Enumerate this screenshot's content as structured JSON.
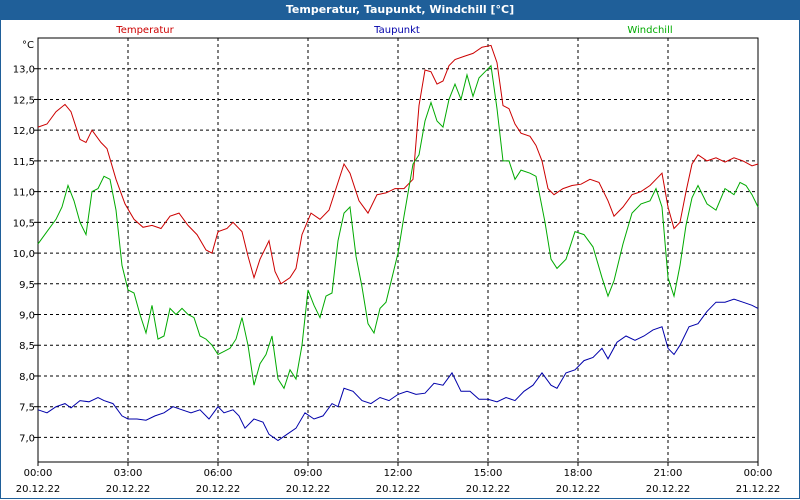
{
  "window": {
    "title": "Temperatur, Taupunkt, Windchill [°C]"
  },
  "chart_data": {
    "type": "line",
    "title": "Temperatur, Taupunkt, Windchill [°C]",
    "ylabel": "°C",
    "ylim": [
      6.6,
      13.5
    ],
    "xlim": [
      0,
      24
    ],
    "grid": true,
    "legend_placement": "top",
    "y_ticks": [
      "7,0",
      "7,5",
      "8,0",
      "8,5",
      "9,0",
      "9,5",
      "10,0",
      "10,5",
      "11,0",
      "11,5",
      "12,0",
      "12,5",
      "13,0"
    ],
    "x_ticks": [
      {
        "time": "00:00",
        "date": "20.12.22"
      },
      {
        "time": "03:00",
        "date": "20.12.22"
      },
      {
        "time": "06:00",
        "date": "20.12.22"
      },
      {
        "time": "09:00",
        "date": "20.12.22"
      },
      {
        "time": "12:00",
        "date": "20.12.22"
      },
      {
        "time": "15:00",
        "date": "20.12.22"
      },
      {
        "time": "18:00",
        "date": "20.12.22"
      },
      {
        "time": "21:00",
        "date": "20.12.22"
      },
      {
        "time": "00:00",
        "date": "21.12.22"
      }
    ],
    "series": [
      {
        "name": "Temperatur",
        "color": "#cc0000",
        "points": [
          [
            0,
            12.05
          ],
          [
            0.3,
            12.1
          ],
          [
            0.6,
            12.3
          ],
          [
            0.9,
            12.42
          ],
          [
            1.1,
            12.3
          ],
          [
            1.4,
            11.85
          ],
          [
            1.6,
            11.8
          ],
          [
            1.8,
            12.0
          ],
          [
            2.1,
            11.8
          ],
          [
            2.3,
            11.7
          ],
          [
            2.6,
            11.2
          ],
          [
            2.9,
            10.8
          ],
          [
            3.2,
            10.55
          ],
          [
            3.5,
            10.42
          ],
          [
            3.8,
            10.45
          ],
          [
            4.1,
            10.4
          ],
          [
            4.4,
            10.6
          ],
          [
            4.7,
            10.65
          ],
          [
            5.0,
            10.45
          ],
          [
            5.3,
            10.3
          ],
          [
            5.6,
            10.05
          ],
          [
            5.8,
            10.0
          ],
          [
            6.0,
            10.35
          ],
          [
            6.3,
            10.4
          ],
          [
            6.5,
            10.5
          ],
          [
            6.8,
            10.35
          ],
          [
            7.0,
            9.95
          ],
          [
            7.2,
            9.6
          ],
          [
            7.4,
            9.9
          ],
          [
            7.7,
            10.2
          ],
          [
            7.9,
            9.7
          ],
          [
            8.1,
            9.5
          ],
          [
            8.4,
            9.6
          ],
          [
            8.6,
            9.75
          ],
          [
            8.8,
            10.3
          ],
          [
            9.1,
            10.65
          ],
          [
            9.4,
            10.55
          ],
          [
            9.7,
            10.7
          ],
          [
            9.9,
            11.0
          ],
          [
            10.2,
            11.45
          ],
          [
            10.4,
            11.3
          ],
          [
            10.7,
            10.85
          ],
          [
            11.0,
            10.65
          ],
          [
            11.3,
            10.95
          ],
          [
            11.6,
            10.98
          ],
          [
            11.9,
            11.05
          ],
          [
            12.2,
            11.05
          ],
          [
            12.5,
            11.2
          ],
          [
            12.7,
            12.4
          ],
          [
            12.9,
            12.98
          ],
          [
            13.1,
            12.95
          ],
          [
            13.3,
            12.75
          ],
          [
            13.5,
            12.8
          ],
          [
            13.7,
            13.05
          ],
          [
            13.9,
            13.15
          ],
          [
            14.2,
            13.2
          ],
          [
            14.5,
            13.25
          ],
          [
            14.8,
            13.35
          ],
          [
            15.1,
            13.38
          ],
          [
            15.3,
            13.1
          ],
          [
            15.5,
            12.4
          ],
          [
            15.7,
            12.35
          ],
          [
            15.9,
            12.1
          ],
          [
            16.1,
            11.95
          ],
          [
            16.4,
            11.9
          ],
          [
            16.6,
            11.75
          ],
          [
            16.8,
            11.5
          ],
          [
            17.0,
            11.05
          ],
          [
            17.2,
            10.95
          ],
          [
            17.5,
            11.05
          ],
          [
            17.8,
            11.1
          ],
          [
            18.1,
            11.12
          ],
          [
            18.4,
            11.2
          ],
          [
            18.7,
            11.15
          ],
          [
            19.0,
            10.85
          ],
          [
            19.2,
            10.6
          ],
          [
            19.5,
            10.75
          ],
          [
            19.8,
            10.95
          ],
          [
            20.1,
            11.0
          ],
          [
            20.4,
            11.1
          ],
          [
            20.6,
            11.2
          ],
          [
            20.8,
            11.3
          ],
          [
            21.0,
            10.75
          ],
          [
            21.2,
            10.4
          ],
          [
            21.4,
            10.5
          ],
          [
            21.6,
            11.0
          ],
          [
            21.8,
            11.45
          ],
          [
            22.0,
            11.6
          ],
          [
            22.3,
            11.5
          ],
          [
            22.6,
            11.55
          ],
          [
            22.9,
            11.48
          ],
          [
            23.2,
            11.55
          ],
          [
            23.5,
            11.5
          ],
          [
            23.8,
            11.42
          ],
          [
            24.0,
            11.45
          ]
        ]
      },
      {
        "name": "Taupunkt",
        "color": "#0000aa",
        "points": [
          [
            0,
            7.45
          ],
          [
            0.3,
            7.4
          ],
          [
            0.6,
            7.5
          ],
          [
            0.9,
            7.55
          ],
          [
            1.1,
            7.48
          ],
          [
            1.4,
            7.6
          ],
          [
            1.7,
            7.58
          ],
          [
            2.0,
            7.65
          ],
          [
            2.2,
            7.6
          ],
          [
            2.5,
            7.55
          ],
          [
            2.8,
            7.35
          ],
          [
            3.0,
            7.3
          ],
          [
            3.3,
            7.3
          ],
          [
            3.6,
            7.28
          ],
          [
            3.9,
            7.35
          ],
          [
            4.2,
            7.4
          ],
          [
            4.5,
            7.5
          ],
          [
            4.8,
            7.45
          ],
          [
            5.1,
            7.4
          ],
          [
            5.4,
            7.45
          ],
          [
            5.7,
            7.3
          ],
          [
            6.0,
            7.5
          ],
          [
            6.2,
            7.4
          ],
          [
            6.5,
            7.45
          ],
          [
            6.7,
            7.35
          ],
          [
            6.9,
            7.15
          ],
          [
            7.2,
            7.3
          ],
          [
            7.5,
            7.25
          ],
          [
            7.7,
            7.05
          ],
          [
            8.0,
            6.95
          ],
          [
            8.3,
            7.05
          ],
          [
            8.6,
            7.15
          ],
          [
            8.9,
            7.4
          ],
          [
            9.2,
            7.3
          ],
          [
            9.5,
            7.35
          ],
          [
            9.8,
            7.55
          ],
          [
            10.0,
            7.5
          ],
          [
            10.2,
            7.8
          ],
          [
            10.5,
            7.75
          ],
          [
            10.8,
            7.6
          ],
          [
            11.1,
            7.55
          ],
          [
            11.4,
            7.65
          ],
          [
            11.7,
            7.6
          ],
          [
            12.0,
            7.7
          ],
          [
            12.3,
            7.75
          ],
          [
            12.6,
            7.7
          ],
          [
            12.9,
            7.72
          ],
          [
            13.2,
            7.88
          ],
          [
            13.5,
            7.85
          ],
          [
            13.8,
            8.05
          ],
          [
            14.1,
            7.75
          ],
          [
            14.4,
            7.75
          ],
          [
            14.7,
            7.62
          ],
          [
            15.0,
            7.62
          ],
          [
            15.3,
            7.58
          ],
          [
            15.6,
            7.65
          ],
          [
            15.9,
            7.6
          ],
          [
            16.2,
            7.75
          ],
          [
            16.5,
            7.85
          ],
          [
            16.8,
            8.05
          ],
          [
            17.1,
            7.85
          ],
          [
            17.3,
            7.8
          ],
          [
            17.6,
            8.05
          ],
          [
            17.9,
            8.1
          ],
          [
            18.2,
            8.25
          ],
          [
            18.5,
            8.3
          ],
          [
            18.8,
            8.45
          ],
          [
            19.0,
            8.28
          ],
          [
            19.3,
            8.55
          ],
          [
            19.6,
            8.65
          ],
          [
            19.9,
            8.58
          ],
          [
            20.2,
            8.65
          ],
          [
            20.5,
            8.75
          ],
          [
            20.8,
            8.8
          ],
          [
            21.0,
            8.45
          ],
          [
            21.2,
            8.35
          ],
          [
            21.4,
            8.5
          ],
          [
            21.7,
            8.8
          ],
          [
            22.0,
            8.85
          ],
          [
            22.3,
            9.05
          ],
          [
            22.6,
            9.2
          ],
          [
            22.9,
            9.2
          ],
          [
            23.2,
            9.25
          ],
          [
            23.5,
            9.2
          ],
          [
            23.8,
            9.15
          ],
          [
            24.0,
            9.1
          ]
        ]
      },
      {
        "name": "Windchill",
        "color": "#00aa00",
        "points": [
          [
            0,
            10.15
          ],
          [
            0.3,
            10.35
          ],
          [
            0.6,
            10.55
          ],
          [
            0.8,
            10.75
          ],
          [
            1.0,
            11.1
          ],
          [
            1.2,
            10.85
          ],
          [
            1.4,
            10.5
          ],
          [
            1.6,
            10.3
          ],
          [
            1.8,
            11.0
          ],
          [
            2.0,
            11.05
          ],
          [
            2.2,
            11.25
          ],
          [
            2.4,
            11.2
          ],
          [
            2.6,
            10.7
          ],
          [
            2.8,
            9.8
          ],
          [
            3.0,
            9.4
          ],
          [
            3.2,
            9.35
          ],
          [
            3.4,
            9.0
          ],
          [
            3.6,
            8.7
          ],
          [
            3.8,
            9.15
          ],
          [
            4.0,
            8.6
          ],
          [
            4.2,
            8.65
          ],
          [
            4.4,
            9.1
          ],
          [
            4.6,
            9.0
          ],
          [
            4.8,
            9.1
          ],
          [
            5.0,
            9.0
          ],
          [
            5.2,
            8.95
          ],
          [
            5.4,
            8.65
          ],
          [
            5.6,
            8.6
          ],
          [
            5.8,
            8.5
          ],
          [
            6.0,
            8.35
          ],
          [
            6.2,
            8.4
          ],
          [
            6.4,
            8.45
          ],
          [
            6.6,
            8.6
          ],
          [
            6.8,
            8.95
          ],
          [
            7.0,
            8.5
          ],
          [
            7.2,
            7.85
          ],
          [
            7.4,
            8.2
          ],
          [
            7.6,
            8.35
          ],
          [
            7.8,
            8.65
          ],
          [
            8.0,
            7.95
          ],
          [
            8.2,
            7.8
          ],
          [
            8.4,
            8.1
          ],
          [
            8.6,
            7.95
          ],
          [
            8.8,
            8.5
          ],
          [
            9.0,
            9.4
          ],
          [
            9.2,
            9.15
          ],
          [
            9.4,
            8.95
          ],
          [
            9.6,
            9.3
          ],
          [
            9.8,
            9.35
          ],
          [
            10.0,
            10.2
          ],
          [
            10.2,
            10.65
          ],
          [
            10.4,
            10.75
          ],
          [
            10.6,
            9.95
          ],
          [
            10.8,
            9.45
          ],
          [
            11.0,
            8.85
          ],
          [
            11.2,
            8.7
          ],
          [
            11.4,
            9.1
          ],
          [
            11.6,
            9.2
          ],
          [
            11.8,
            9.6
          ],
          [
            12.0,
            10.0
          ],
          [
            12.2,
            10.6
          ],
          [
            12.5,
            11.45
          ],
          [
            12.7,
            11.6
          ],
          [
            12.9,
            12.15
          ],
          [
            13.1,
            12.45
          ],
          [
            13.3,
            12.15
          ],
          [
            13.5,
            12.05
          ],
          [
            13.7,
            12.5
          ],
          [
            13.9,
            12.75
          ],
          [
            14.1,
            12.5
          ],
          [
            14.3,
            12.9
          ],
          [
            14.5,
            12.55
          ],
          [
            14.7,
            12.85
          ],
          [
            14.9,
            12.95
          ],
          [
            15.1,
            13.05
          ],
          [
            15.3,
            12.35
          ],
          [
            15.5,
            11.5
          ],
          [
            15.7,
            11.5
          ],
          [
            15.9,
            11.2
          ],
          [
            16.1,
            11.35
          ],
          [
            16.4,
            11.3
          ],
          [
            16.6,
            11.25
          ],
          [
            16.9,
            10.5
          ],
          [
            17.1,
            9.9
          ],
          [
            17.3,
            9.75
          ],
          [
            17.6,
            9.9
          ],
          [
            17.9,
            10.35
          ],
          [
            18.2,
            10.3
          ],
          [
            18.5,
            10.1
          ],
          [
            18.8,
            9.6
          ],
          [
            19.0,
            9.3
          ],
          [
            19.2,
            9.55
          ],
          [
            19.5,
            10.15
          ],
          [
            19.8,
            10.65
          ],
          [
            20.1,
            10.8
          ],
          [
            20.4,
            10.85
          ],
          [
            20.6,
            11.05
          ],
          [
            20.8,
            10.75
          ],
          [
            21.0,
            9.6
          ],
          [
            21.2,
            9.3
          ],
          [
            21.4,
            9.8
          ],
          [
            21.6,
            10.45
          ],
          [
            21.8,
            10.9
          ],
          [
            22.0,
            11.1
          ],
          [
            22.3,
            10.8
          ],
          [
            22.6,
            10.7
          ],
          [
            22.9,
            11.05
          ],
          [
            23.2,
            10.95
          ],
          [
            23.4,
            11.15
          ],
          [
            23.6,
            11.1
          ],
          [
            23.8,
            10.95
          ],
          [
            24.0,
            10.75
          ]
        ]
      }
    ]
  }
}
